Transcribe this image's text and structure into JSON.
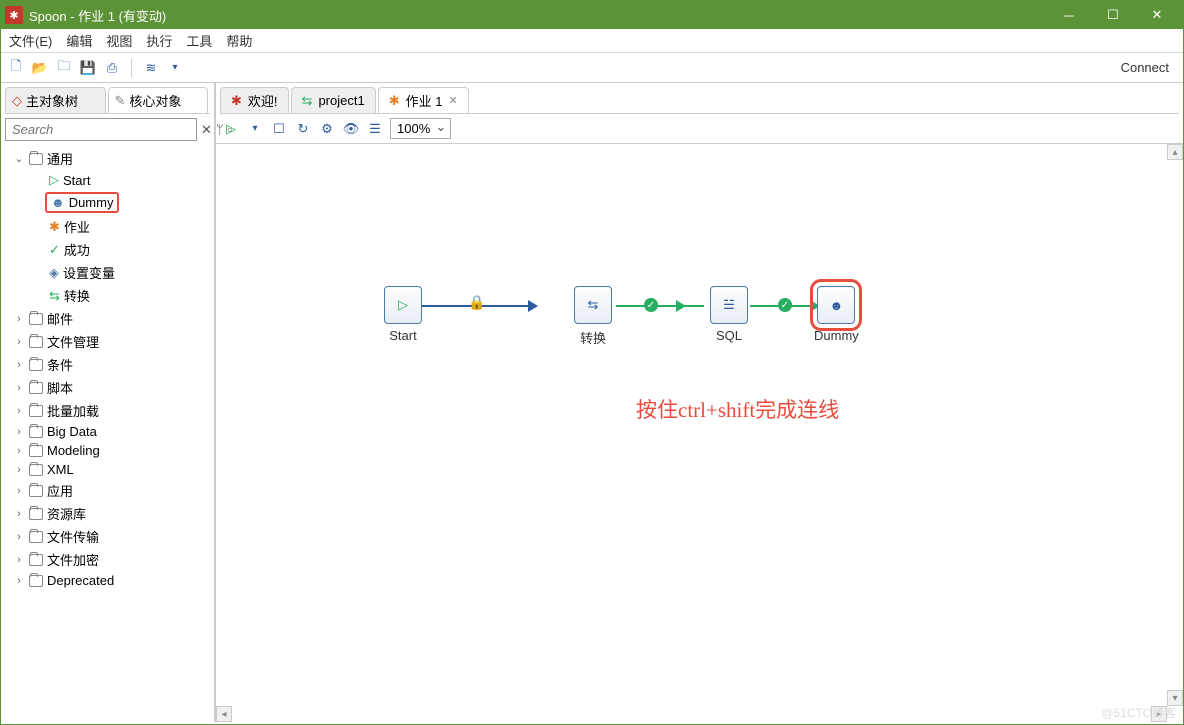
{
  "window": {
    "title": "Spoon - 作业 1 (有变动)"
  },
  "menu": {
    "file": "文件(E)",
    "edit": "编辑",
    "view": "视图",
    "action": "执行",
    "tools": "工具",
    "help": "帮助"
  },
  "toolbar": {
    "connect": "Connect"
  },
  "sidebar": {
    "tabs": {
      "view": "主对象树",
      "design": "核心对象"
    },
    "search": {
      "placeholder": "Search"
    },
    "generic": {
      "label": "通用",
      "items": {
        "start": "Start",
        "dummy": "Dummy",
        "job": "作业",
        "success": "成功",
        "setvar": "设置变量",
        "transform": "转换"
      }
    },
    "folders": [
      "邮件",
      "文件管理",
      "条件",
      "脚本",
      "批量加载",
      "Big Data",
      "Modeling",
      "XML",
      "应用",
      "资源库",
      "文件传输",
      "文件加密",
      "Deprecated"
    ]
  },
  "worktabs": {
    "welcome": "欢迎!",
    "project": "project1",
    "job": "作业 1"
  },
  "worktoolbar": {
    "zoom": "100%"
  },
  "canvas": {
    "nodes": {
      "start": "Start",
      "transform": "转换",
      "sql": "SQL",
      "dummy": "Dummy"
    },
    "annotation": "按住ctrl+shift完成连线"
  },
  "watermark": "@51CTO博客"
}
